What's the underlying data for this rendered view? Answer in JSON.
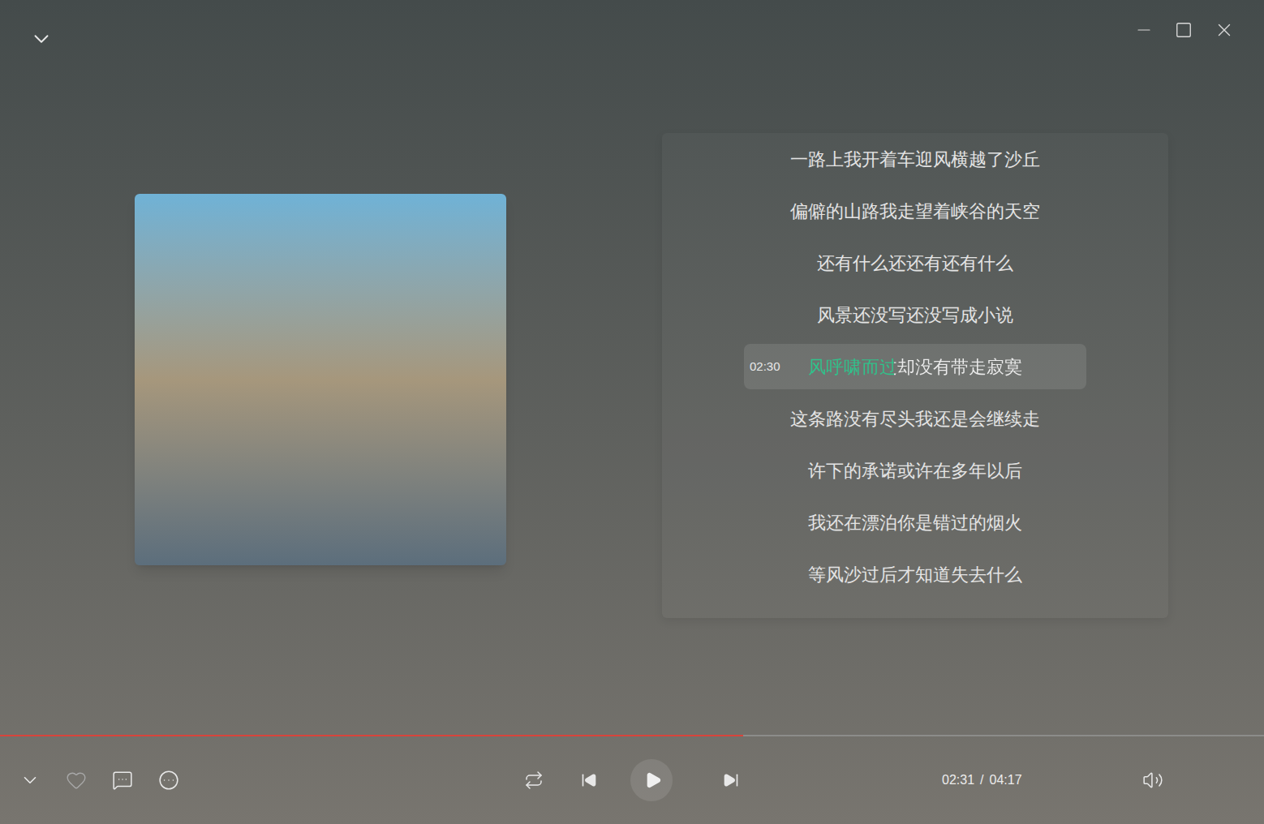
{
  "lyrics": {
    "lines": [
      {
        "text": "一路上我开着车迎风横越了沙丘",
        "selected": false
      },
      {
        "text": "偏僻的山路我走望着峡谷的天空",
        "selected": false
      },
      {
        "text": "还有什么还还有还有什么",
        "selected": false
      },
      {
        "text": "风景还没写还没写成小说",
        "selected": false
      },
      {
        "text": "风呼啸而过却没有带走寂寞",
        "selected": true,
        "time": "02:30",
        "level": 0.4
      },
      {
        "text": "这条路没有尽头我还是会继续走",
        "selected": false
      },
      {
        "text": "许下的承诺或许在多年以后",
        "selected": false
      },
      {
        "text": "我还在漂泊你是错过的烟火",
        "selected": false
      },
      {
        "text": "等风沙过后才知道失去什么",
        "selected": false
      }
    ]
  },
  "player": {
    "playing": false,
    "favorite": false,
    "level": 0.588,
    "position": "02:31",
    "separator": "/",
    "duration": "04:17"
  }
}
